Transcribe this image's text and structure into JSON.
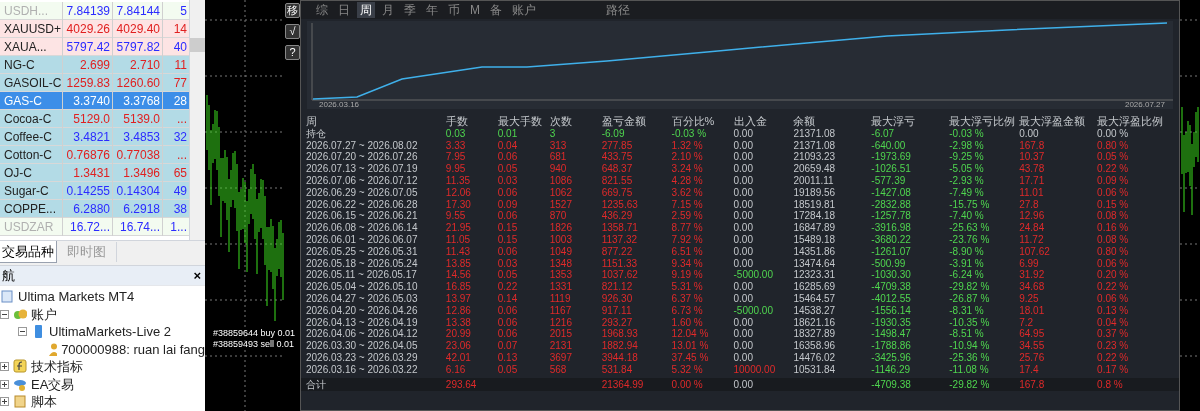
{
  "market_watch": {
    "rows": [
      {
        "symbol": "USDH...",
        "bid": "7.84139",
        "ask": "7.84144",
        "spread": "5",
        "rising": true,
        "kind": "forex",
        "dimmed": true,
        "selected": false
      },
      {
        "symbol": "XAUUSD+",
        "bid": "4029.26",
        "ask": "4029.40",
        "spread": "14",
        "rising": false,
        "kind": "metal",
        "dimmed": false,
        "selected": false
      },
      {
        "symbol": "XAUA...",
        "bid": "5797.42",
        "ask": "5797.82",
        "spread": "40",
        "rising": true,
        "kind": "metal",
        "dimmed": false,
        "selected": false
      },
      {
        "symbol": "NG-C",
        "bid": "2.699",
        "ask": "2.710",
        "spread": "11",
        "rising": false,
        "kind": "commodity",
        "dimmed": false,
        "selected": false
      },
      {
        "symbol": "GASOIL-C",
        "bid": "1259.83",
        "ask": "1260.60",
        "spread": "77",
        "rising": false,
        "kind": "commodity",
        "dimmed": false,
        "selected": false
      },
      {
        "symbol": "GAS-C",
        "bid": "3.3740",
        "ask": "3.3768",
        "spread": "28",
        "rising": true,
        "kind": "commodity",
        "dimmed": false,
        "selected": true
      },
      {
        "symbol": "Cocoa-C",
        "bid": "5129.0",
        "ask": "5139.0",
        "spread": "...",
        "rising": false,
        "kind": "commodity",
        "dimmed": false,
        "selected": false
      },
      {
        "symbol": "Coffee-C",
        "bid": "3.4821",
        "ask": "3.4853",
        "spread": "32",
        "rising": true,
        "kind": "commodity",
        "dimmed": false,
        "selected": false
      },
      {
        "symbol": "Cotton-C",
        "bid": "0.76876",
        "ask": "0.77038",
        "spread": "...",
        "rising": false,
        "kind": "commodity",
        "dimmed": false,
        "selected": false
      },
      {
        "symbol": "OJ-C",
        "bid": "1.3431",
        "ask": "1.3496",
        "spread": "65",
        "rising": false,
        "kind": "commodity",
        "dimmed": false,
        "selected": false
      },
      {
        "symbol": "Sugar-C",
        "bid": "0.14255",
        "ask": "0.14304",
        "spread": "49",
        "rising": true,
        "kind": "commodity",
        "dimmed": false,
        "selected": false
      },
      {
        "symbol": "COPPE...",
        "bid": "6.2880",
        "ask": "6.2918",
        "spread": "38",
        "rising": true,
        "kind": "commodity",
        "dimmed": false,
        "selected": false
      },
      {
        "symbol": "USDZAR",
        "bid": "16.72...",
        "ask": "16.74...",
        "spread": "1...",
        "rising": true,
        "kind": "forex",
        "dimmed": true,
        "selected": false
      }
    ]
  },
  "bottom_tabs": [
    {
      "label": "交易品种",
      "selected": true
    },
    {
      "label": "即时图",
      "selected": false
    }
  ],
  "navigator": {
    "title": "航",
    "close": "×",
    "tree": [
      {
        "label": "Ultima Markets MT4",
        "kind": "root",
        "children": [
          {
            "label": "账户",
            "kind": "accounts",
            "expanded": true,
            "children": [
              {
                "label": "UltimaMarkets-Live 2",
                "kind": "server",
                "expanded": true,
                "children": [
                  {
                    "label": "700000988: ruan lai fang",
                    "kind": "user"
                  }
                ]
              }
            ]
          },
          {
            "label": "技术指标",
            "kind": "indicators",
            "expanded": false
          },
          {
            "label": "EA交易",
            "kind": "experts",
            "expanded": false
          },
          {
            "label": "脚本",
            "kind": "scripts",
            "expanded": false
          }
        ]
      }
    ]
  },
  "price_chart": {
    "orders": [
      "#38859644 buy 0.01",
      "#38859493 sell 0.01"
    ]
  },
  "side_buttons": [
    "移",
    "√",
    "?"
  ],
  "report": {
    "tabs": [
      {
        "label": "综",
        "selected": false
      },
      {
        "label": "日",
        "selected": false
      },
      {
        "label": "周",
        "selected": true
      },
      {
        "label": "月",
        "selected": false
      },
      {
        "label": "季",
        "selected": false
      },
      {
        "label": "年",
        "selected": false
      },
      {
        "label": "币",
        "selected": false
      },
      {
        "label": "M",
        "selected": false
      },
      {
        "label": "备",
        "selected": false
      },
      {
        "label": "账户",
        "selected": false
      },
      {
        "label": "路径",
        "selected": false
      }
    ],
    "equity_chart": {
      "start_label": "2026.03.16",
      "end_label": "2026.07.27"
    },
    "columns": [
      "周",
      "手数",
      "最大手数",
      "次数",
      "盈亏金额",
      "百分比%",
      "出入金",
      "余额",
      "最大浮亏",
      "最大浮亏比例",
      "最大浮盈金额",
      "最大浮盈比例"
    ],
    "rows": [
      {
        "kind": "open",
        "cells": [
          "持仓",
          "0.03",
          "0.01",
          "3",
          "-6.09",
          "-0.03 %",
          "0.00",
          "21371.08",
          "-6.07",
          "-0.03 %",
          "0.00",
          "0.00 %"
        ]
      },
      {
        "kind": "week",
        "cells": [
          "2026.07.27 ~ 2026.08.02",
          "3.33",
          "0.04",
          "313",
          "277.85",
          "1.32 %",
          "0.00",
          "21371.08",
          "-640.00",
          "-2.98 %",
          "167.8",
          "0.80 %"
        ]
      },
      {
        "kind": "week",
        "cells": [
          "2026.07.20 ~ 2026.07.26",
          "7.95",
          "0.06",
          "681",
          "433.75",
          "2.10 %",
          "0.00",
          "21093.23",
          "-1973.69",
          "-9.25 %",
          "10.37",
          "0.05 %"
        ]
      },
      {
        "kind": "week",
        "cells": [
          "2026.07.13 ~ 2026.07.19",
          "9.95",
          "0.05",
          "940",
          "648.37",
          "3.24 %",
          "0.00",
          "20659.48",
          "-1026.51",
          "-5.05 %",
          "43.78",
          "0.22 %"
        ]
      },
      {
        "kind": "week",
        "cells": [
          "2026.07.06 ~ 2026.07.12",
          "11.35",
          "0.03",
          "1086",
          "821.55",
          "4.28 %",
          "0.00",
          "20011.11",
          "-577.39",
          "-2.93 %",
          "17.71",
          "0.09 %"
        ]
      },
      {
        "kind": "week",
        "cells": [
          "2026.06.29 ~ 2026.07.05",
          "12.06",
          "0.06",
          "1062",
          "669.75",
          "3.62 %",
          "0.00",
          "19189.56",
          "-1427.08",
          "-7.49 %",
          "11.01",
          "0.06 %"
        ]
      },
      {
        "kind": "week",
        "cells": [
          "2026.06.22 ~ 2026.06.28",
          "17.30",
          "0.09",
          "1527",
          "1235.63",
          "7.15 %",
          "0.00",
          "18519.81",
          "-2832.88",
          "-15.75 %",
          "27.8",
          "0.15 %"
        ]
      },
      {
        "kind": "week",
        "cells": [
          "2026.06.15 ~ 2026.06.21",
          "9.55",
          "0.06",
          "870",
          "436.29",
          "2.59 %",
          "0.00",
          "17284.18",
          "-1257.78",
          "-7.40 %",
          "12.96",
          "0.08 %"
        ]
      },
      {
        "kind": "week",
        "cells": [
          "2026.06.08 ~ 2026.06.14",
          "21.95",
          "0.15",
          "1826",
          "1358.71",
          "8.77 %",
          "0.00",
          "16847.89",
          "-3916.98",
          "-25.63 %",
          "24.84",
          "0.16 %"
        ]
      },
      {
        "kind": "week",
        "cells": [
          "2026.06.01 ~ 2026.06.07",
          "11.05",
          "0.15",
          "1003",
          "1137.32",
          "7.92 %",
          "0.00",
          "15489.18",
          "-3680.22",
          "-23.76 %",
          "11.72",
          "0.08 %"
        ]
      },
      {
        "kind": "week",
        "cells": [
          "2026.05.25 ~ 2026.05.31",
          "11.43",
          "0.06",
          "1049",
          "877.22",
          "6.51 %",
          "0.00",
          "14351.86",
          "-1261.07",
          "-8.90 %",
          "107.62",
          "0.80 %"
        ]
      },
      {
        "kind": "week",
        "cells": [
          "2026.05.18 ~ 2026.05.24",
          "13.85",
          "0.03",
          "1348",
          "1151.33",
          "9.34 %",
          "0.00",
          "13474.64",
          "-500.99",
          "-3.91 %",
          "6.99",
          "0.06 %"
        ]
      },
      {
        "kind": "withdrawal",
        "cells": [
          "2026.05.11 ~ 2026.05.17",
          "14.56",
          "0.05",
          "1353",
          "1037.62",
          "9.19 %",
          "-5000.00",
          "12323.31",
          "-1030.30",
          "-6.24 %",
          "31.92",
          "0.20 %"
        ]
      },
      {
        "kind": "week",
        "cells": [
          "2026.05.04 ~ 2026.05.10",
          "16.85",
          "0.22",
          "1331",
          "821.12",
          "5.31 %",
          "0.00",
          "16285.69",
          "-4709.38",
          "-29.82 %",
          "34.68",
          "0.22 %"
        ]
      },
      {
        "kind": "week",
        "cells": [
          "2026.04.27 ~ 2026.05.03",
          "13.97",
          "0.14",
          "1119",
          "926.30",
          "6.37 %",
          "0.00",
          "15464.57",
          "-4012.55",
          "-26.87 %",
          "9.25",
          "0.06 %"
        ]
      },
      {
        "kind": "withdrawal",
        "cells": [
          "2026.04.20 ~ 2026.04.26",
          "12.86",
          "0.06",
          "1167",
          "917.11",
          "6.73 %",
          "-5000.00",
          "14538.27",
          "-1556.14",
          "-8.31 %",
          "18.01",
          "0.13 %"
        ]
      },
      {
        "kind": "week",
        "cells": [
          "2026.04.13 ~ 2026.04.19",
          "13.38",
          "0.06",
          "1216",
          "293.27",
          "1.60 %",
          "0.00",
          "18621.16",
          "-1930.35",
          "-10.35 %",
          "7.2",
          "0.04 %"
        ]
      },
      {
        "kind": "week",
        "cells": [
          "2026.04.06 ~ 2026.04.12",
          "20.99",
          "0.06",
          "2015",
          "1968.93",
          "12.04 %",
          "0.00",
          "18327.89",
          "-1498.47",
          "-8.51 %",
          "64.95",
          "0.37 %"
        ]
      },
      {
        "kind": "week",
        "cells": [
          "2026.03.30 ~ 2026.04.05",
          "23.06",
          "0.07",
          "2131",
          "1882.94",
          "13.01 %",
          "0.00",
          "16358.96",
          "-1788.86",
          "-10.94 %",
          "34.55",
          "0.23 %"
        ]
      },
      {
        "kind": "week",
        "cells": [
          "2026.03.23 ~ 2026.03.29",
          "42.01",
          "0.13",
          "3697",
          "3944.18",
          "37.45 %",
          "0.00",
          "14476.02",
          "-3425.96",
          "-25.36 %",
          "25.76",
          "0.22 %"
        ]
      },
      {
        "kind": "deposit",
        "cells": [
          "2026.03.16 ~ 2026.03.22",
          "6.16",
          "0.05",
          "568",
          "531.84",
          "5.32 %",
          "10000.00",
          "10531.84",
          "-1146.29",
          "-11.08 %",
          "17.4",
          "0.17 %"
        ]
      },
      {
        "kind": "total",
        "cells": [
          "合计",
          "293.64",
          null,
          null,
          "21364.99",
          "0.00 %",
          "0.00",
          null,
          "-4709.38",
          "-29.82 %",
          "167.8",
          "0.8 %"
        ]
      }
    ]
  }
}
